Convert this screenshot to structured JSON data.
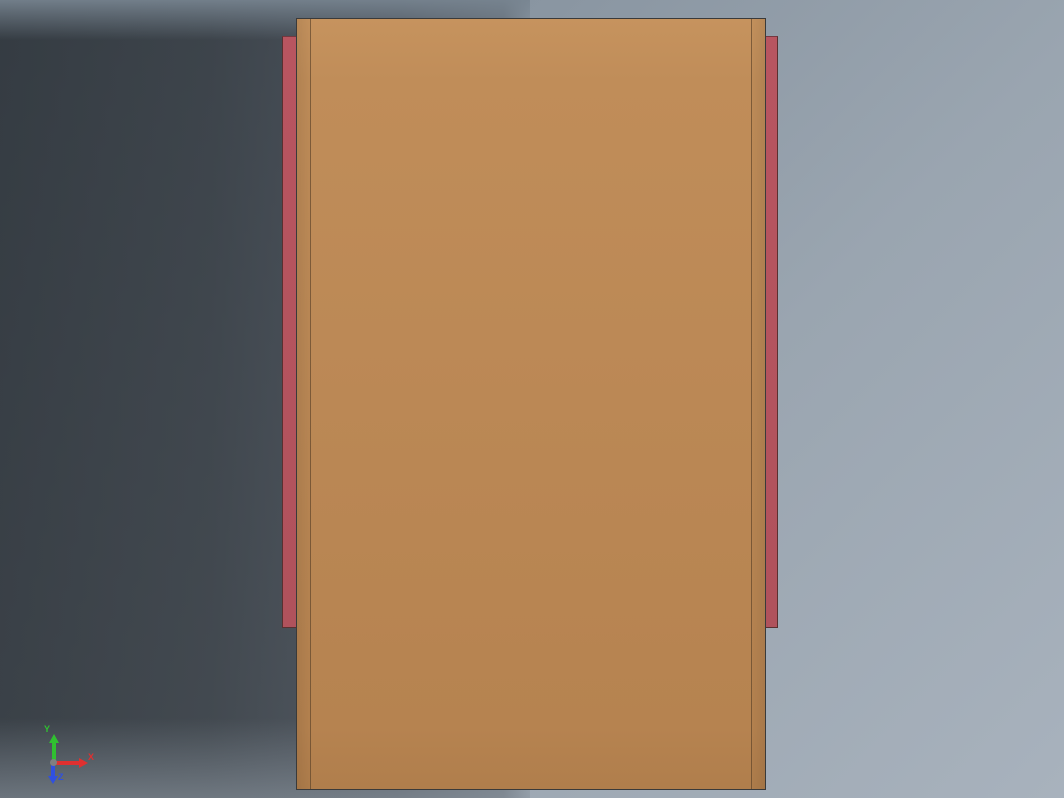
{
  "viewport": {
    "type": "3d-cad-viewport"
  },
  "model": {
    "visible_parts": [
      "front-panel",
      "side-rails"
    ],
    "front_panel_color": "#bb8855",
    "side_rail_color": "#b0525c"
  },
  "axis_triad": {
    "x_label": "X",
    "y_label": "Y",
    "z_label": "Z",
    "x_color": "#e03030",
    "y_color": "#30c030",
    "z_color": "#3050e0"
  }
}
